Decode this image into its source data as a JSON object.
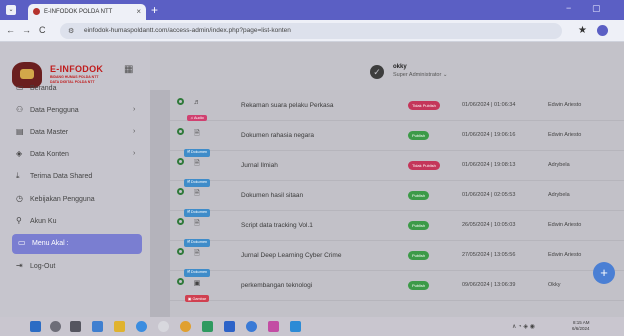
{
  "browser": {
    "tab_title": "E-INFODOK POLDA NTT",
    "tab_close": "×",
    "new_tab": "+",
    "menu": "⌄",
    "minimize": "−",
    "maximize": "▢",
    "url": "einfodok-humaspoldantt.com/access-admin/index.php?page=list-konten",
    "back": "←",
    "forward": "→",
    "reload": "C",
    "star": "★"
  },
  "sidebar": {
    "brand_name": "E-INFODOK",
    "brand_sub1": "BIDANG HUMAS POLDA NTT",
    "brand_sub2": "DATA DIGITAL POLDA NTT",
    "items": [
      {
        "label": "Beranda",
        "icon": "▭",
        "chevron": ""
      },
      {
        "label": "Data Pengguna",
        "icon": "⚇",
        "chevron": "›"
      },
      {
        "label": "Data Master",
        "icon": "▤",
        "chevron": "›"
      },
      {
        "label": "Data Konten",
        "icon": "◈",
        "chevron": "›"
      },
      {
        "label": "Terima Data Shared",
        "icon": "⤓",
        "chevron": ""
      },
      {
        "label": "Kebijakan Pengguna",
        "icon": "◷",
        "chevron": ""
      },
      {
        "label": "Akun Ku",
        "icon": "⚲",
        "chevron": ""
      },
      {
        "label": "Menu Akal :",
        "icon": "▭",
        "chevron": ""
      },
      {
        "label": "Log-Out",
        "icon": "⇥",
        "chevron": ""
      }
    ]
  },
  "header": {
    "check": "✓",
    "user_name": "okky",
    "user_role": "Super Administrator ⌄"
  },
  "rows": [
    {
      "chip": "♫ Audio",
      "chip_type": "aud",
      "doc_icon": "♬",
      "title": "Rekaman suara pelaku Perkasa",
      "status": "Tidak Publish",
      "status_type": "draft",
      "date": "01/06/2024 | 01:06:34",
      "author": "Edwin Ariesto"
    },
    {
      "chip": "🗎 Dokumen",
      "chip_type": "dok",
      "doc_icon": "🗎",
      "title": "Dokumen rahasia negara",
      "status": "Publish",
      "status_type": "pub",
      "date": "01/06/2024 | 19:06:16",
      "author": "Edwin Ariesto"
    },
    {
      "chip": "🗎 Dokumen",
      "chip_type": "dok",
      "doc_icon": "🗎",
      "title": "Jurnal Ilmiah",
      "status": "Tidak Publish",
      "status_type": "draft",
      "date": "01/06/2024 | 19:08:13",
      "author": "Adrybela"
    },
    {
      "chip": "🗎 Dokumen",
      "chip_type": "dok",
      "doc_icon": "🗎",
      "title": "Dokumen hasil sitaan",
      "status": "Publish",
      "status_type": "pub",
      "date": "01/06/2024 | 02:05:53",
      "author": "Adrybela"
    },
    {
      "chip": "🗎 Dokumen",
      "chip_type": "dok",
      "doc_icon": "🗎",
      "title": "Script data tracking Vol.1",
      "status": "Publish",
      "status_type": "pub",
      "date": "26/05/2024 | 10:05:03",
      "author": "Edwin Ariesto"
    },
    {
      "chip": "🗎 Dokumen",
      "chip_type": "dok",
      "doc_icon": "🗎",
      "title": "Jurnal Deep Learning Cyber Crime",
      "status": "Publish",
      "status_type": "pub",
      "date": "27/05/2024 | 13:05:56",
      "author": "Edwin Ariesto"
    },
    {
      "chip": "▣ Gambar",
      "chip_type": "gam",
      "doc_icon": "▣",
      "title": "perkembangan teknologi",
      "status": "Publish",
      "status_type": "pub",
      "date": "09/06/2024 | 13:06:39",
      "author": "Okky"
    }
  ],
  "fab": "+",
  "taskbar": {
    "time": "8:15 AM",
    "date": "6/6/2024",
    "tray": "∧ ◔ ◈ ◉"
  }
}
